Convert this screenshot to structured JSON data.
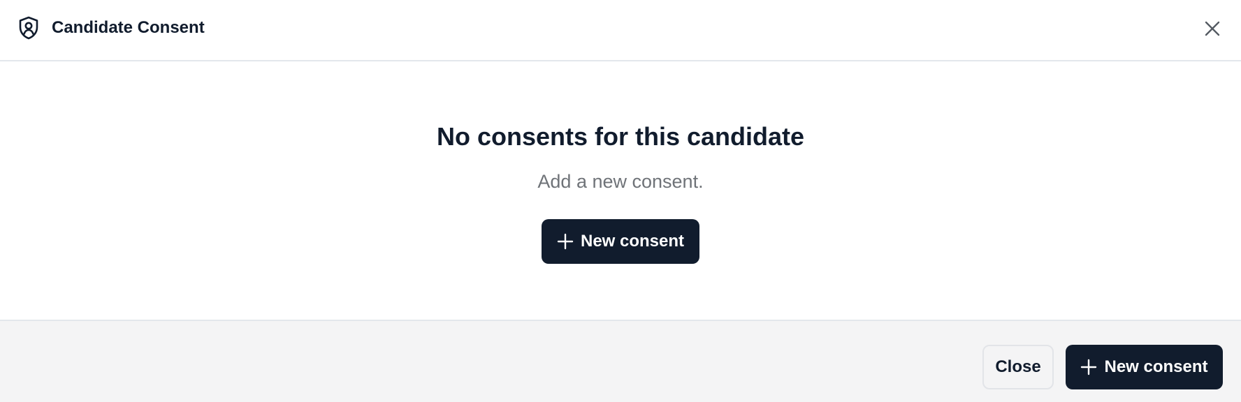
{
  "dialog": {
    "title": "Candidate Consent",
    "header_icon": "shield-user-icon",
    "close_icon": "close-icon"
  },
  "empty_state": {
    "title": "No consents for this candidate",
    "subtitle": "Add a new consent.",
    "button_label": "New consent",
    "button_icon": "plus-icon"
  },
  "footer": {
    "close_label": "Close",
    "new_consent_label": "New consent",
    "new_consent_icon": "plus-icon"
  },
  "colors": {
    "primary": "#111c2d",
    "footer_bg": "#f4f4f5",
    "muted_text": "#6f7378",
    "border": "#e3e7ec"
  }
}
